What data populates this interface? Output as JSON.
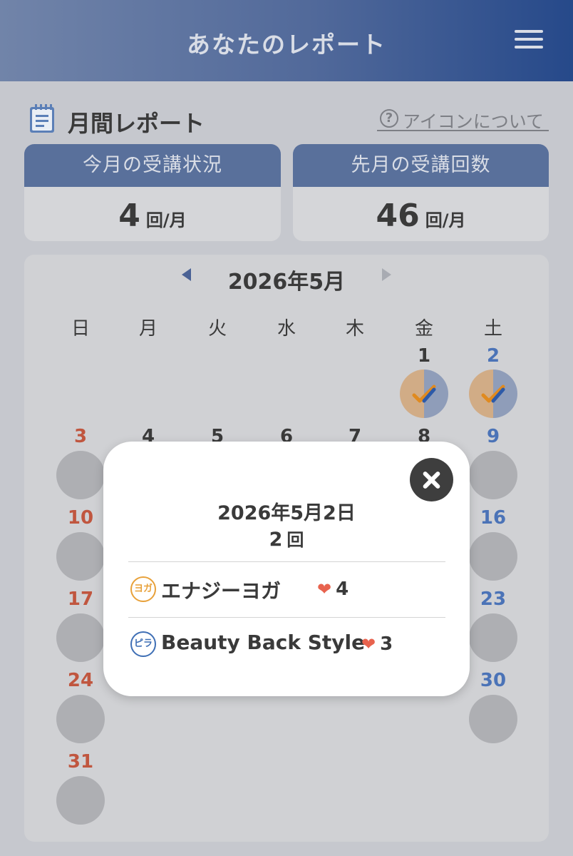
{
  "header": {
    "title": "あなたのレポート",
    "menu_icon": "hamburger-menu-icon"
  },
  "section": {
    "title": "月間レポート",
    "icon": "notepad-icon",
    "help_link": "アイコンについて",
    "help_icon": "question-circle-icon"
  },
  "stats": [
    {
      "title": "今月の受講状況",
      "value": "4",
      "unit": "回/月"
    },
    {
      "title": "先月の受講回数",
      "value": "46",
      "unit": "回/月"
    }
  ],
  "calendar": {
    "month_label": "2026年5月",
    "weekdays": [
      "日",
      "月",
      "火",
      "水",
      "木",
      "金",
      "土"
    ],
    "visible_days": [
      {
        "day": "1",
        "col": 5,
        "row": 0,
        "attended": true
      },
      {
        "day": "2",
        "col": 6,
        "row": 0,
        "attended": true
      },
      {
        "day": "3",
        "col": 0,
        "row": 1
      },
      {
        "day": "4",
        "col": 1,
        "row": 1
      },
      {
        "day": "5",
        "col": 2,
        "row": 1
      },
      {
        "day": "6",
        "col": 3,
        "row": 1
      },
      {
        "day": "7",
        "col": 4,
        "row": 1
      },
      {
        "day": "8",
        "col": 5,
        "row": 1
      },
      {
        "day": "9",
        "col": 6,
        "row": 1
      },
      {
        "day": "10",
        "col": 0,
        "row": 2
      },
      {
        "day": "16",
        "col": 6,
        "row": 2
      },
      {
        "day": "17",
        "col": 0,
        "row": 3
      },
      {
        "day": "23",
        "col": 6,
        "row": 3
      },
      {
        "day": "24",
        "col": 0,
        "row": 4
      },
      {
        "day": "30",
        "col": 6,
        "row": 4
      },
      {
        "day": "31",
        "col": 0,
        "row": 5
      }
    ],
    "colors": {
      "sunday": "#c0563f",
      "saturday": "#4b73b7",
      "empty_circle": "#aeafb3"
    }
  },
  "modal": {
    "date": "2026年5月2日",
    "count": "2",
    "count_unit": "回",
    "close_icon": "close-x-icon",
    "classes": [
      {
        "badge": "ヨガ",
        "badge_color": "#e8a13a",
        "name": "エナジーヨガ",
        "likes": "4"
      },
      {
        "badge": "ピラ",
        "badge_color": "#3f6fb5",
        "name": "Beauty Back Style",
        "likes": "3"
      }
    ]
  }
}
